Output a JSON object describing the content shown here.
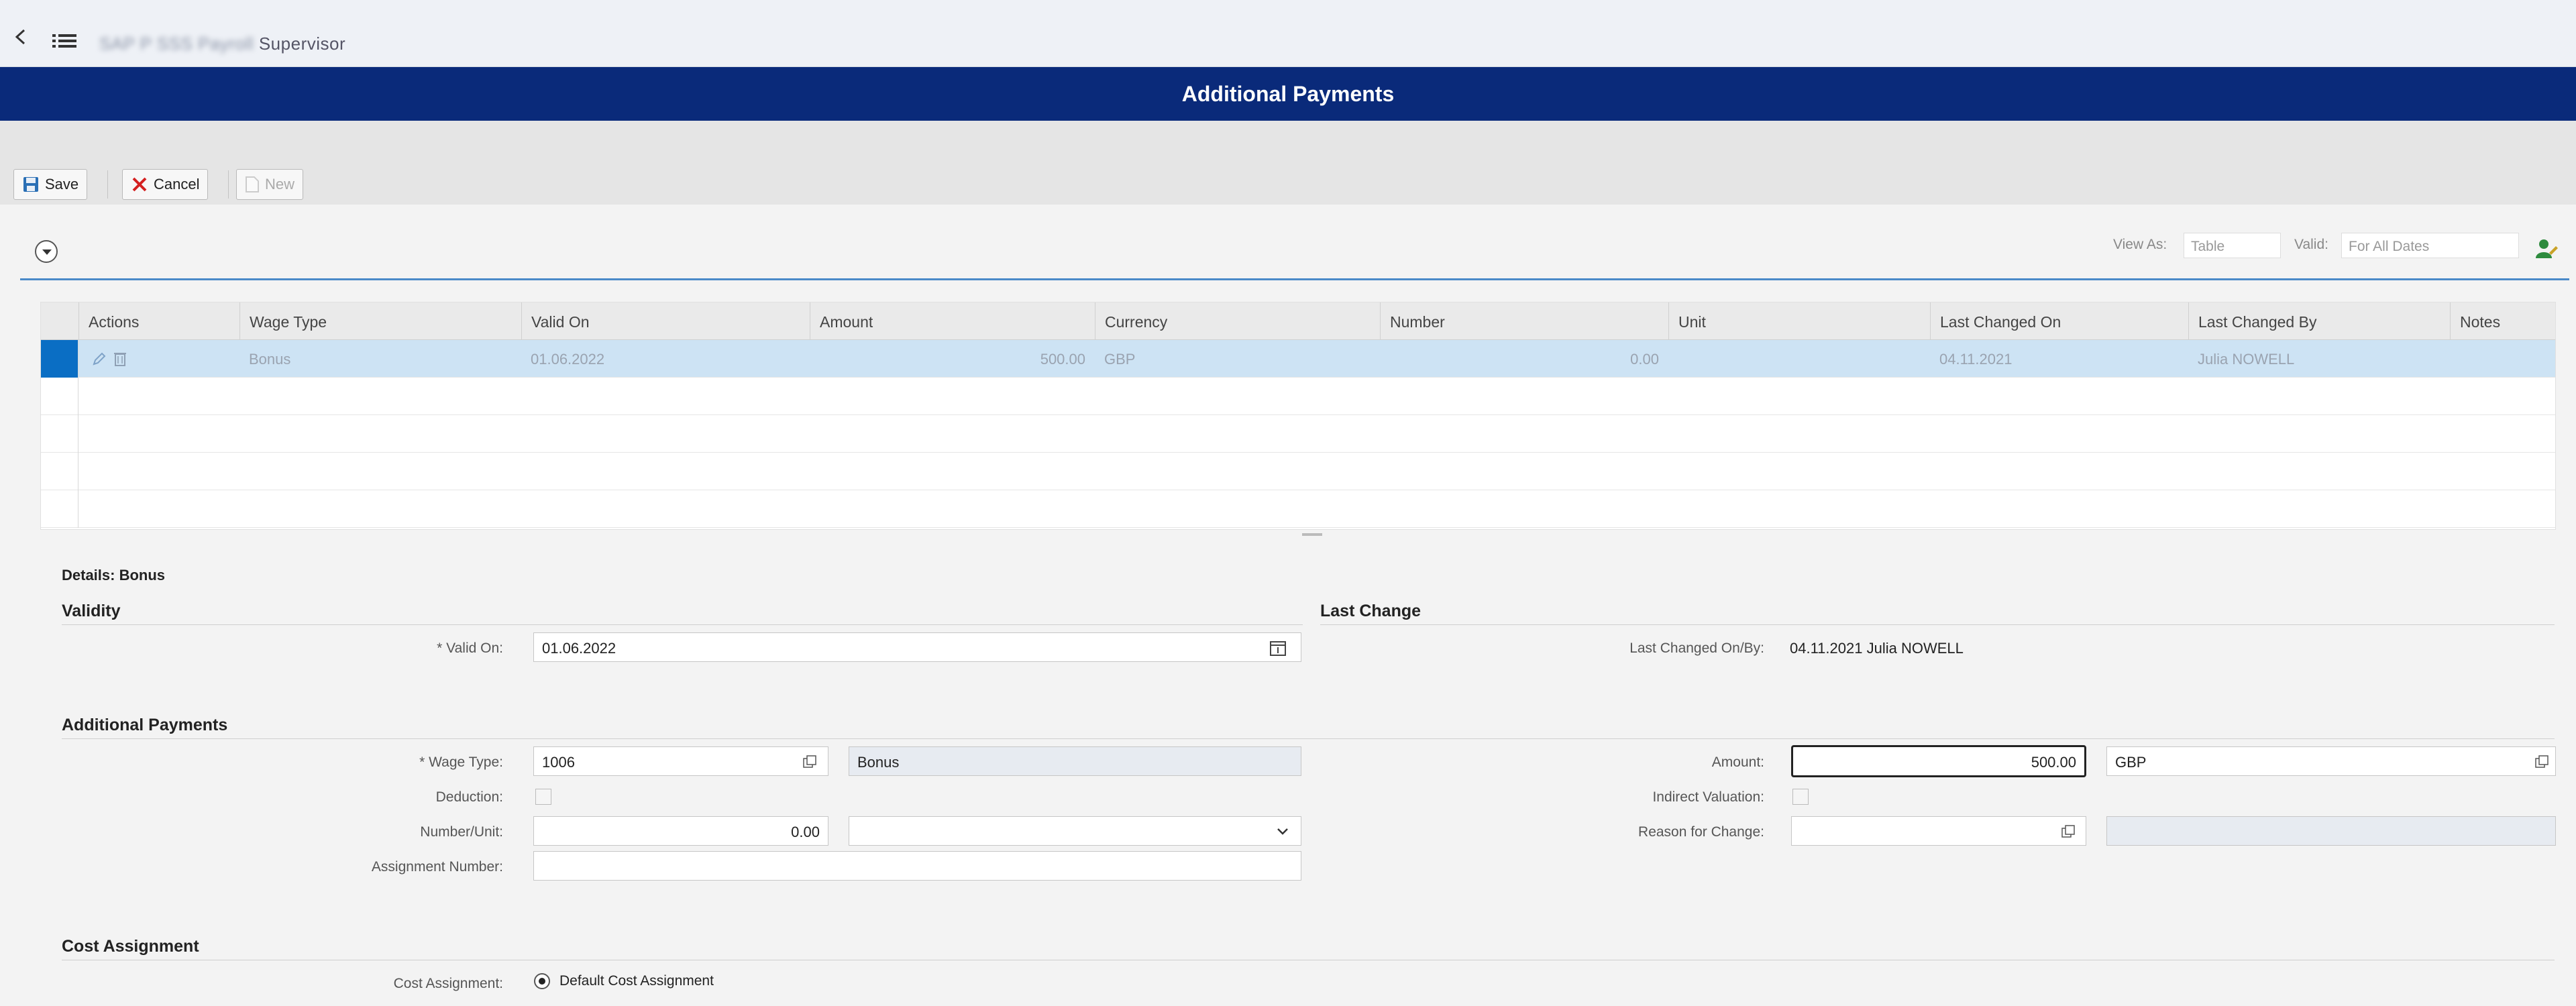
{
  "header": {
    "breadcrumb_blurred": "SAP P SSS Payroll",
    "breadcrumb_app": "Supervisor",
    "page_title": "Additional Payments"
  },
  "toolbar": {
    "save_label": "Save",
    "cancel_label": "Cancel",
    "new_label": "New"
  },
  "view": {
    "view_as_label": "View As:",
    "view_as_value": "Table",
    "valid_label": "Valid:",
    "valid_value": "For All Dates"
  },
  "grid": {
    "columns": [
      "Actions",
      "Wage Type",
      "Valid On",
      "Amount",
      "Currency",
      "Number",
      "Unit",
      "Last Changed On",
      "Last Changed By",
      "Notes"
    ],
    "rows": [
      {
        "wage_type": "Bonus",
        "valid_on": "01.06.2022",
        "amount": "500.00",
        "currency": "GBP",
        "number": "0.00",
        "unit": "",
        "last_changed_on": "04.11.2021",
        "last_changed_by": "Julia NOWELL",
        "notes": ""
      }
    ]
  },
  "details": {
    "title": "Details: Bonus",
    "validity_section": "Validity",
    "valid_on_label": "* Valid On:",
    "valid_on_value": "01.06.2022",
    "last_change_section": "Last Change",
    "last_changed_label": "Last Changed On/By:",
    "last_changed_value": "04.11.2021 Julia NOWELL",
    "payments_section": "Additional Payments",
    "wage_type_label": "* Wage Type:",
    "wage_type_value": "1006",
    "wage_type_text": "Bonus",
    "deduction_label": "Deduction:",
    "number_unit_label": "Number/Unit:",
    "number_value": "0.00",
    "assignment_label": "Assignment Number:",
    "amount_label": "Amount:",
    "amount_value": "500.00",
    "currency_value": "GBP",
    "indirect_label": "Indirect Valuation:",
    "reason_label": "Reason for Change:",
    "cost_section": "Cost Assignment",
    "cost_label": "Cost Assignment:",
    "cost_option": "Default Cost Assignment"
  }
}
